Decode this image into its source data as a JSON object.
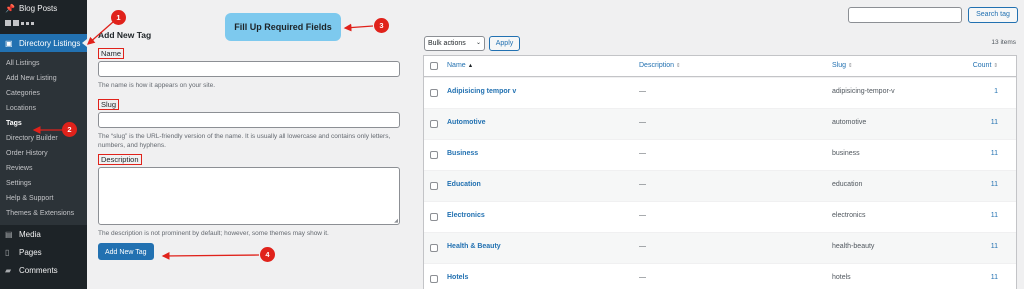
{
  "sidebar": {
    "blog_posts": "Blog Posts",
    "active_menu": "Directory Listings",
    "submenu": [
      "All Listings",
      "Add New Listing",
      "Categories",
      "Locations",
      "Tags",
      "Directory Builder",
      "Order History",
      "Reviews",
      "Settings",
      "Help & Support",
      "Themes & Extensions"
    ],
    "current_submenu": "Tags",
    "media": "Media",
    "pages": "Pages",
    "comments": "Comments"
  },
  "form": {
    "title": "Add New Tag",
    "name_label": "Name",
    "name_help": "The name is how it appears on your site.",
    "slug_label": "Slug",
    "slug_help": "The “slug” is the URL-friendly version of the name. It is usually all lowercase and contains only letters, numbers, and hyphens.",
    "description_label": "Description",
    "description_help": "The description is not prominent by default; however, some themes may show it.",
    "submit_label": "Add New Tag"
  },
  "callout": "Fill Up Required Fields",
  "markers": [
    "1",
    "2",
    "3",
    "4"
  ],
  "search": {
    "button_label": "Search tag"
  },
  "bulk": {
    "label": "Bulk actions",
    "apply_label": "Apply"
  },
  "items_count": "13 items",
  "table": {
    "columns": [
      "Name",
      "Description",
      "Slug",
      "Count"
    ],
    "rows": [
      {
        "name": "Adipisicing tempor v",
        "description": "—",
        "slug": "adipisicing-tempor-v",
        "count": "1"
      },
      {
        "name": "Automotive",
        "description": "—",
        "slug": "automotive",
        "count": "11"
      },
      {
        "name": "Business",
        "description": "—",
        "slug": "business",
        "count": "11"
      },
      {
        "name": "Education",
        "description": "—",
        "slug": "education",
        "count": "11"
      },
      {
        "name": "Electronics",
        "description": "—",
        "slug": "electronics",
        "count": "11"
      },
      {
        "name": "Health & Beauty",
        "description": "—",
        "slug": "health-beauty",
        "count": "11"
      },
      {
        "name": "Hotels",
        "description": "—",
        "slug": "hotels",
        "count": "11"
      }
    ]
  },
  "colors": {
    "accent": "#2271b1",
    "annotation": "#e0221b",
    "callout": "#7dc9ee",
    "sidebar": "#1d2327"
  }
}
